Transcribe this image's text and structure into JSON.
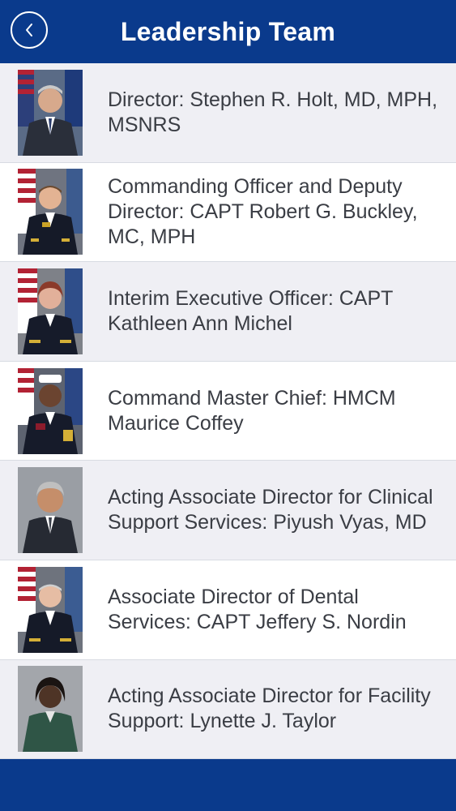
{
  "header": {
    "title": "Leadership Team",
    "back_icon": "chevron-left-icon"
  },
  "colors": {
    "header_bg": "#0a3a8c",
    "row_alt_bg": "#efeff4",
    "row_text": "#3a3d44"
  },
  "leaders": [
    {
      "label": "Director: Stephen R. Holt, MD, MPH, MSNRS",
      "photo": "portrait-civilian-flags"
    },
    {
      "label": "Commanding Officer and Deputy Director: CAPT Robert G. Buckley, MC, MPH",
      "photo": "portrait-navy-officer"
    },
    {
      "label": "Interim Executive Officer: CAPT Kathleen Ann Michel",
      "photo": "portrait-navy-officer"
    },
    {
      "label": "Command Master Chief: HMCM Maurice Coffey",
      "photo": "portrait-navy-chief"
    },
    {
      "label": "Acting Associate Director for Clinical Support Services: Piyush Vyas, MD",
      "photo": "portrait-civilian"
    },
    {
      "label": "Associate Director of Dental Services: CAPT Jeffery S. Nordin",
      "photo": "portrait-navy-officer"
    },
    {
      "label": "Acting Associate Director for Facility Support: Lynette J. Taylor",
      "photo": "portrait-civilian"
    }
  ]
}
